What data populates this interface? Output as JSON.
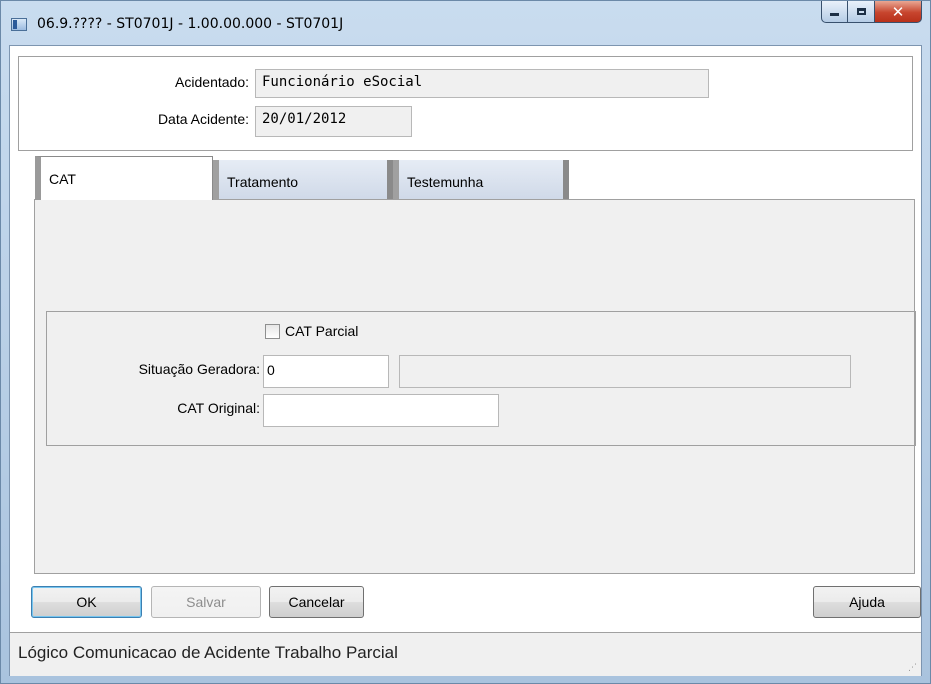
{
  "window": {
    "title": "06.9.???? - ST0701J - 1.00.00.000 - ST0701J",
    "icon": "app-window-icon",
    "controls": {
      "minimize": "minimize",
      "maximize": "maximize",
      "close": "x"
    }
  },
  "header": {
    "acidentado_label": "Acidentado:",
    "acidentado_value": "Funcionário eSocial",
    "data_label": "Data Acidente:",
    "data_value": "20/01/2012"
  },
  "tabs": [
    {
      "label": "CAT",
      "active": true
    },
    {
      "label": "Tratamento",
      "active": false
    },
    {
      "label": "Testemunha",
      "active": false
    }
  ],
  "cat_panel": {
    "cat_parcial_label": "CAT Parcial",
    "cat_parcial_checked": false,
    "situacao_label": "Situação Geradora:",
    "situacao_value": "0",
    "situacao_desc": "",
    "cat_original_label": "CAT Original:",
    "cat_original_value": ""
  },
  "buttons": {
    "ok": "OK",
    "salvar": "Salvar",
    "cancelar": "Cancelar",
    "ajuda": "Ajuda"
  },
  "status": {
    "text": "Lógico Comunicacao de Acidente Trabalho Parcial"
  },
  "colors": {
    "frame": "#b9d1ea",
    "panel_bg": "#f0f0f0",
    "close_button": "#c7452e"
  }
}
